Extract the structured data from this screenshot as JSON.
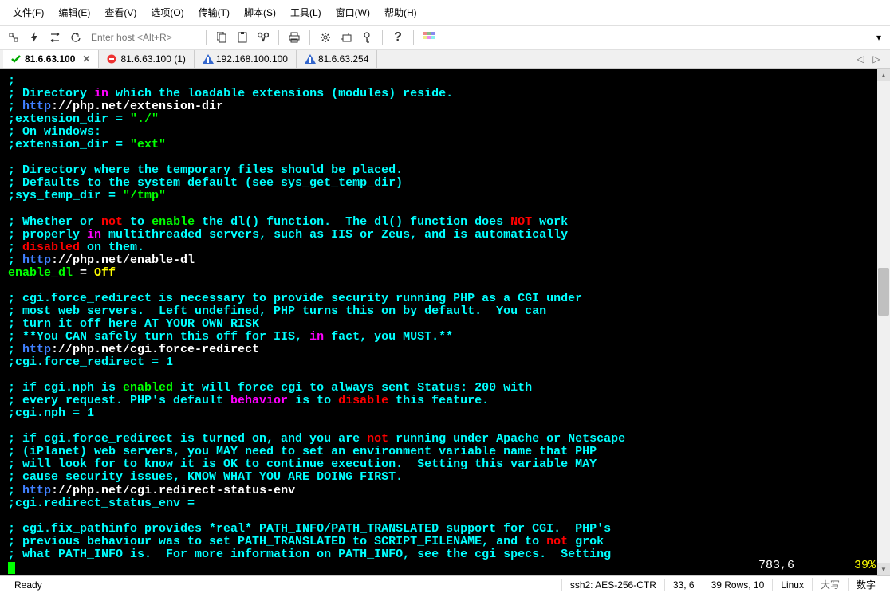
{
  "menu": {
    "file": "文件(F)",
    "edit": "编辑(E)",
    "view": "查看(V)",
    "options": "选项(O)",
    "transfer": "传输(T)",
    "script": "脚本(S)",
    "tools": "工具(L)",
    "window": "窗口(W)",
    "help": "帮助(H)"
  },
  "toolbar": {
    "host_placeholder": "Enter host <Alt+R>"
  },
  "tabs": [
    {
      "label": "81.6.63.100",
      "status": "ok",
      "active": true,
      "closable": true
    },
    {
      "label": "81.6.63.100 (1)",
      "status": "stop",
      "active": false,
      "closable": false
    },
    {
      "label": "192.168.100.100",
      "status": "warn",
      "active": false,
      "closable": false
    },
    {
      "label": "81.6.63.254",
      "status": "warn",
      "active": false,
      "closable": false
    }
  ],
  "terminal": {
    "lines": [
      [
        {
          "c": "cyan",
          "t": ";"
        }
      ],
      [
        {
          "c": "cyan",
          "t": "; Directory "
        },
        {
          "c": "magenta",
          "t": "in"
        },
        {
          "c": "cyan",
          "t": " which the loadable extensions (modules) reside."
        }
      ],
      [
        {
          "c": "cyan",
          "t": "; "
        },
        {
          "c": "blue",
          "t": "http"
        },
        {
          "c": "white",
          "t": "://php.net/extension-dir"
        }
      ],
      [
        {
          "c": "cyan",
          "t": ";extension_dir = "
        },
        {
          "c": "green",
          "t": "\"./\""
        }
      ],
      [
        {
          "c": "cyan",
          "t": "; On windows:"
        }
      ],
      [
        {
          "c": "cyan",
          "t": ";extension_dir = "
        },
        {
          "c": "green",
          "t": "\"ext\""
        }
      ],
      [
        {
          "c": "cyan",
          "t": ""
        }
      ],
      [
        {
          "c": "cyan",
          "t": "; Directory where the temporary files should be placed."
        }
      ],
      [
        {
          "c": "cyan",
          "t": "; Defaults to the system default (see sys_get_temp_dir)"
        }
      ],
      [
        {
          "c": "cyan",
          "t": ";sys_temp_dir = "
        },
        {
          "c": "green",
          "t": "\"/tmp\""
        }
      ],
      [
        {
          "c": "cyan",
          "t": ""
        }
      ],
      [
        {
          "c": "cyan",
          "t": "; Whether or "
        },
        {
          "c": "red",
          "t": "not"
        },
        {
          "c": "cyan",
          "t": " to "
        },
        {
          "c": "green",
          "t": "enable"
        },
        {
          "c": "cyan",
          "t": " the dl() function.  The dl() function does "
        },
        {
          "c": "red",
          "t": "NOT"
        },
        {
          "c": "cyan",
          "t": " work"
        }
      ],
      [
        {
          "c": "cyan",
          "t": "; properly "
        },
        {
          "c": "magenta",
          "t": "in"
        },
        {
          "c": "cyan",
          "t": " multithreaded servers, such as IIS or Zeus, and is automatically"
        }
      ],
      [
        {
          "c": "cyan",
          "t": "; "
        },
        {
          "c": "red",
          "t": "disabled"
        },
        {
          "c": "cyan",
          "t": " on them."
        }
      ],
      [
        {
          "c": "cyan",
          "t": "; "
        },
        {
          "c": "blue",
          "t": "http"
        },
        {
          "c": "white",
          "t": "://php.net/enable-dl"
        }
      ],
      [
        {
          "c": "green",
          "t": "enable_dl"
        },
        {
          "c": "white",
          "t": " = "
        },
        {
          "c": "yellow",
          "t": "Off"
        }
      ],
      [
        {
          "c": "cyan",
          "t": ""
        }
      ],
      [
        {
          "c": "cyan",
          "t": "; cgi.force_redirect is necessary to provide security running PHP as a CGI under"
        }
      ],
      [
        {
          "c": "cyan",
          "t": "; most web servers.  Left undefined, PHP turns this on by default.  You can"
        }
      ],
      [
        {
          "c": "cyan",
          "t": "; turn it off here AT YOUR OWN RISK"
        }
      ],
      [
        {
          "c": "cyan",
          "t": "; **You CAN safely turn this off for IIS, "
        },
        {
          "c": "magenta",
          "t": "in"
        },
        {
          "c": "cyan",
          "t": " fact, you MUST.**"
        }
      ],
      [
        {
          "c": "cyan",
          "t": "; "
        },
        {
          "c": "blue",
          "t": "http"
        },
        {
          "c": "white",
          "t": "://php.net/cgi.force-redirect"
        }
      ],
      [
        {
          "c": "cyan",
          "t": ";cgi.force_redirect = 1"
        }
      ],
      [
        {
          "c": "cyan",
          "t": ""
        }
      ],
      [
        {
          "c": "cyan",
          "t": "; if cgi.nph is "
        },
        {
          "c": "green",
          "t": "enabled"
        },
        {
          "c": "cyan",
          "t": " it will force cgi to always sent Status: 200 with"
        }
      ],
      [
        {
          "c": "cyan",
          "t": "; every request. PHP's default "
        },
        {
          "c": "magenta",
          "t": "behavior"
        },
        {
          "c": "cyan",
          "t": " is to "
        },
        {
          "c": "red",
          "t": "disable"
        },
        {
          "c": "cyan",
          "t": " this feature."
        }
      ],
      [
        {
          "c": "cyan",
          "t": ";cgi.nph = 1"
        }
      ],
      [
        {
          "c": "cyan",
          "t": ""
        }
      ],
      [
        {
          "c": "cyan",
          "t": "; if cgi.force_redirect is turned on, and you are "
        },
        {
          "c": "red",
          "t": "not"
        },
        {
          "c": "cyan",
          "t": " running under Apache or Netscape"
        }
      ],
      [
        {
          "c": "cyan",
          "t": "; (iPlanet) web servers, you MAY need to set an environment variable name that PHP"
        }
      ],
      [
        {
          "c": "cyan",
          "t": "; will look for to know it is OK to continue execution.  Setting this variable MAY"
        }
      ],
      [
        {
          "c": "cyan",
          "t": "; cause security issues, KNOW WHAT YOU ARE DOING FIRST."
        }
      ],
      [
        {
          "c": "cyan",
          "t": "; "
        },
        {
          "c": "blue",
          "t": "http"
        },
        {
          "c": "white",
          "t": "://php.net/cgi.redirect-status-env"
        }
      ],
      [
        {
          "c": "cyan",
          "t": ";cgi.redirect_status_env ="
        }
      ],
      [
        {
          "c": "cyan",
          "t": ""
        }
      ],
      [
        {
          "c": "cyan",
          "t": "; cgi.fix_pathinfo provides *real* PATH_INFO/PATH_TRANSLATED support for CGI.  PHP's"
        }
      ],
      [
        {
          "c": "cyan",
          "t": "; previous behaviour was to set PATH_TRANSLATED to SCRIPT_FILENAME, and to "
        },
        {
          "c": "red",
          "t": "not"
        },
        {
          "c": "cyan",
          "t": " grok"
        }
      ],
      [
        {
          "c": "cyan",
          "t": "; what PATH_INFO is.  For more information on PATH_INFO, see the cgi specs.  Setting"
        }
      ]
    ],
    "position": "783,6",
    "percent": "39%"
  },
  "status": {
    "ready": "Ready",
    "conn": "ssh2: AES-256-CTR",
    "pos": "33,   6",
    "size": "39 Rows, 10",
    "os": "Linux",
    "caps": "大写",
    "num": "数字"
  }
}
